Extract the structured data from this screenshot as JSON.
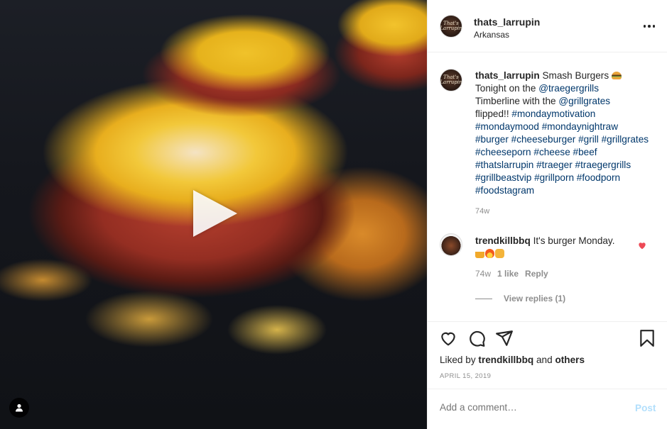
{
  "header": {
    "username": "thats_larrupin",
    "location": "Arkansas",
    "avatar_text": "That's Larrupin"
  },
  "caption": {
    "username": "thats_larrupin",
    "text_before": "Smash Burgers ",
    "emoji": "burger-emoji",
    "line2_prefix": "Tonight on the ",
    "mention1": "@traegergrills",
    "line3_prefix": "Timberline with the ",
    "mention2": "@grillgrates",
    "line4_prefix": "flipped!! ",
    "hashtags": "#mondaymotivation #mondaymood #mondaynightraw #burger #cheeseburger #grill #grillgrates #cheeseporn #cheese #beef #thatslarrupin #traeger #traegergrills #grillbeastvip #grillporn #foodporn #foodstagram",
    "time": "74w"
  },
  "comment": {
    "username": "trendkillbbq",
    "text": "It's burger Monday.",
    "emojis": [
      "beer-emoji",
      "fire-emoji",
      "fist-emoji"
    ],
    "time": "74w",
    "likes": "1 like",
    "reply": "Reply",
    "view_replies": "View replies (1)"
  },
  "actions": {
    "liked_prefix": "Liked by ",
    "liked_user": "trendkillbbq",
    "liked_and": " and ",
    "liked_others": "others",
    "date": "APRIL 15, 2019"
  },
  "add_comment": {
    "placeholder": "Add a comment…",
    "post_label": "Post"
  },
  "colors": {
    "link": "#00376b",
    "secondary": "#8e8e8e",
    "like_red": "#ed4956",
    "post_disabled": "#b2dffc"
  }
}
